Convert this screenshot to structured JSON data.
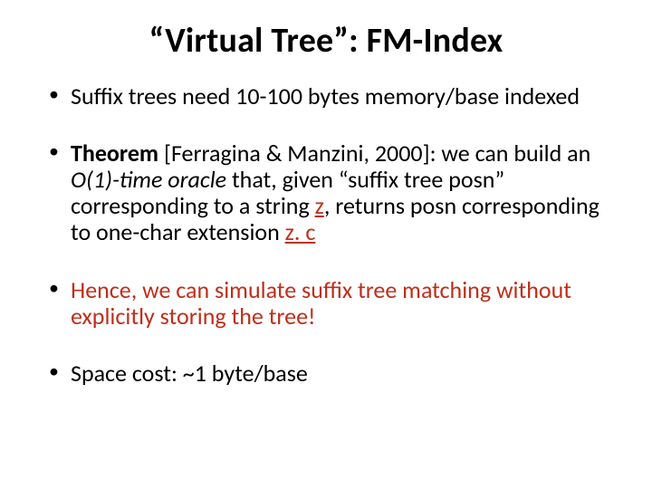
{
  "title": "“Virtual Tree”: FM-Index",
  "bullets": {
    "b1": "Suffix trees need 10-100 bytes memory/base indexed",
    "b2": {
      "theorem_label": "Theorem",
      "citation": " [Ferragina & Manzini, 2000]: we can build an ",
      "oracle": "O(1)-time oracle",
      "mid1": " that, given “suffix tree posn” corresponding to a string ",
      "z1": "z",
      "mid2": ", returns posn corresponding to one-char extension ",
      "zc": "z. c"
    },
    "b3": "Hence, we can simulate suffix tree matching without explicitly storing the tree!",
    "b4": "Space cost: ~1 byte/base"
  }
}
